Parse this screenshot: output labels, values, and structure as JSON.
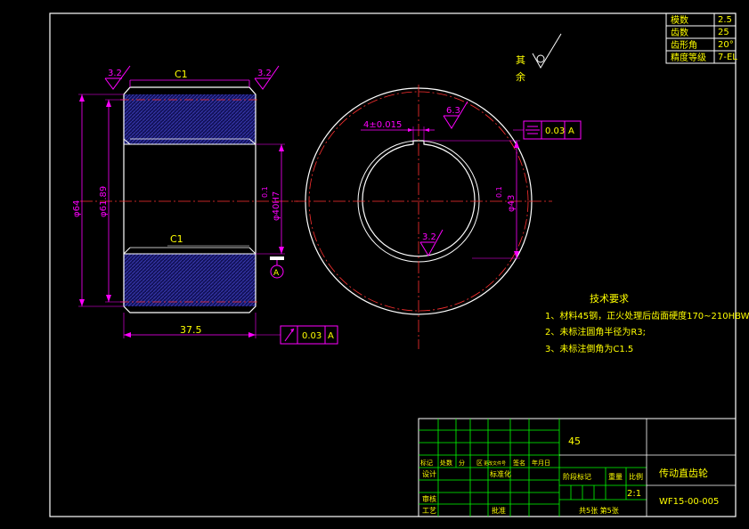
{
  "params_table": [
    {
      "label": "模数",
      "value": "2.5"
    },
    {
      "label": "齿数",
      "value": "25"
    },
    {
      "label": "齿形角",
      "value": "20°"
    },
    {
      "label": "精度等级",
      "value": "7-EL"
    }
  ],
  "left_view": {
    "chamfer_top": "C1",
    "chamfer_inner": "C1",
    "roughness_left": "3.2",
    "roughness_right": "3.2",
    "dim_outer_dia": "φ64",
    "dim_pitch_dia": "φ61.89",
    "dim_bore": "φ40H7",
    "dim_bore_tol": "0.1",
    "dim_width": "37.5",
    "datum_label": "A",
    "runout_tol": "0.03",
    "runout_datum": "A"
  },
  "right_view": {
    "keyway_width": "4±0.015",
    "keyway_roughness": "6.3",
    "bore_roughness": "3.2",
    "dim_keyway_depth": "φ43",
    "dim_keyway_tol": "0.1",
    "symmetry_tol": "0.03",
    "symmetry_datum": "A"
  },
  "other_roughness": {
    "line1": "其",
    "line2": "余"
  },
  "tech_req": {
    "title": "技术要求",
    "items": [
      "1、材料45钢，正火处理后齿面硬度170~210HBW;",
      "2、未标注圆角半径为R3;",
      "3、未标注倒角为C1.5"
    ]
  },
  "title_block": {
    "material": "45",
    "part_name": "传动直齿轮",
    "drawing_no": "WF15-00-005",
    "scale": "2:1",
    "sheets": "共5张 第5张",
    "header_row": [
      "标记",
      "处数",
      "分",
      "区",
      "更改文件号",
      "签名",
      "年月日"
    ],
    "design": "设计",
    "std": "标准化",
    "stage_headers": [
      "阶段标记",
      "重量",
      "比例"
    ],
    "review": "审核",
    "process": "工艺",
    "approve": "批准"
  }
}
